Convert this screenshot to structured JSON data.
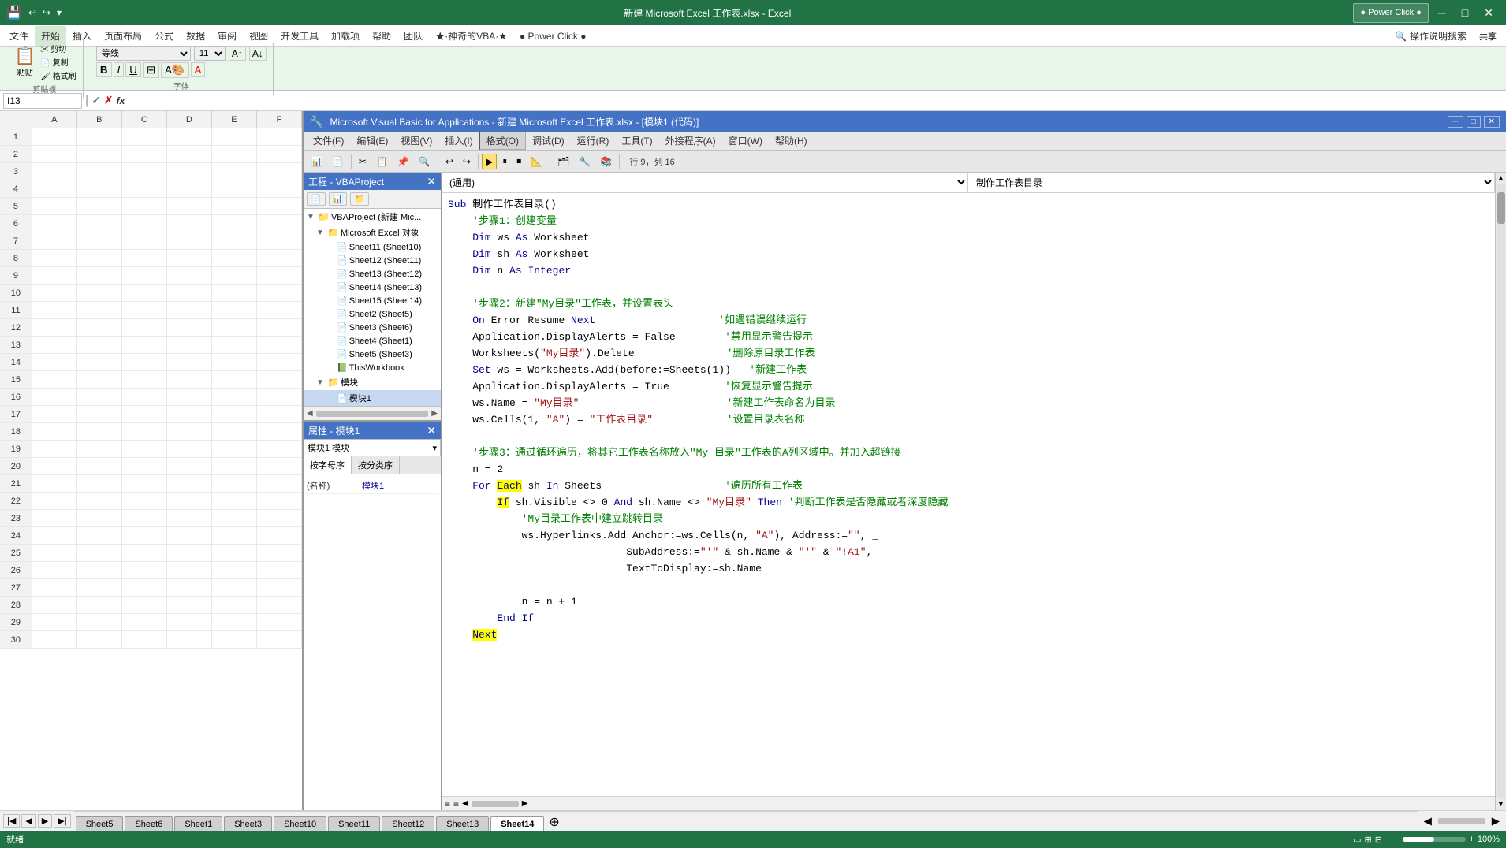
{
  "excel": {
    "title": "新建 Microsoft Excel 工作表.xlsx - Excel",
    "tabs": [
      "Sheet5",
      "Sheet6",
      "Sheet1",
      "Sheet3",
      "Sheet10",
      "Sheet11",
      "Sheet12",
      "Sheet13",
      "Sheet14"
    ],
    "active_tab": "Sheet14",
    "name_box": "I13",
    "ribbon": {
      "active_tab": "开始",
      "tabs": [
        "文件",
        "开始",
        "插入",
        "页面布局",
        "公式",
        "数据",
        "审阅",
        "视图",
        "开发工具",
        "加载项",
        "帮助",
        "团队",
        "★·神奇的VBA·★",
        "● Power Click ●",
        "操作说明搜索"
      ]
    }
  },
  "vba": {
    "title": "Microsoft Visual Basic for Applications - 新建 Microsoft Excel 工作表.xlsx - [模块1 (代码)]",
    "menus": [
      "文件(F)",
      "编辑(E)",
      "视图(V)",
      "插入(I)",
      "格式(O)",
      "调试(D)",
      "运行(R)",
      "工具(T)",
      "外接程序(A)",
      "窗口(W)",
      "帮助(H)"
    ],
    "active_menu": "格式(O)",
    "row_col": "行 9，列 16",
    "left_dropdown": "(通用)",
    "right_dropdown": "制作工作表目录",
    "project_panel": {
      "title": "工程 - VBAProject",
      "items": [
        {
          "label": "VBAProject (新建 Mic...",
          "level": 0,
          "type": "project",
          "expanded": true
        },
        {
          "label": "Microsoft Excel 对象",
          "level": 1,
          "type": "folder",
          "expanded": true
        },
        {
          "label": "Sheet11 (Sheet10)",
          "level": 2,
          "type": "sheet"
        },
        {
          "label": "Sheet12 (Sheet11)",
          "level": 2,
          "type": "sheet"
        },
        {
          "label": "Sheet13 (Sheet12)",
          "level": 2,
          "type": "sheet"
        },
        {
          "label": "Sheet14 (Sheet13)",
          "level": 2,
          "type": "sheet"
        },
        {
          "label": "Sheet15 (Sheet14)",
          "level": 2,
          "type": "sheet"
        },
        {
          "label": "Sheet2 (Sheet5)",
          "level": 2,
          "type": "sheet"
        },
        {
          "label": "Sheet3 (Sheet6)",
          "level": 2,
          "type": "sheet"
        },
        {
          "label": "Sheet4 (Sheet1)",
          "level": 2,
          "type": "sheet"
        },
        {
          "label": "Sheet5 (Sheet3)",
          "level": 2,
          "type": "sheet"
        },
        {
          "label": "ThisWorkbook",
          "level": 2,
          "type": "workbook"
        },
        {
          "label": "模块",
          "level": 1,
          "type": "folder",
          "expanded": true
        },
        {
          "label": "模块1",
          "level": 2,
          "type": "module",
          "selected": true
        }
      ]
    },
    "properties_panel": {
      "title": "属性 - 模块1",
      "dropdown": "模块1 模块",
      "tabs": [
        "按字母序",
        "按分类序"
      ],
      "active_tab": "按字母序",
      "name_value": "模块1"
    },
    "code": [
      {
        "type": "code",
        "content": "Sub 制作工作表目录()"
      },
      {
        "type": "comment",
        "content": "    '步骤1：创建变量"
      },
      {
        "type": "code",
        "content": "    Dim ws As Worksheet"
      },
      {
        "type": "code",
        "content": "    Dim sh As Worksheet"
      },
      {
        "type": "code",
        "content": "    Dim n As Integer"
      },
      {
        "type": "empty",
        "content": ""
      },
      {
        "type": "comment",
        "content": "    '步骤2：新建\"My目录\"工作表，并设置表头"
      },
      {
        "type": "code",
        "content": "    On Error Resume Next                    '如遇错误继续运行"
      },
      {
        "type": "code",
        "content": "    Application.DisplayAlerts = False        '禁用显示警告提示"
      },
      {
        "type": "code",
        "content": "    Worksheets(\"My目录\").Delete               '删除原目录工作表"
      },
      {
        "type": "code",
        "content": "    Set ws = Worksheets.Add(before:=Sheets(1))   '新建工作表"
      },
      {
        "type": "code",
        "content": "    Application.DisplayAlerts = True         '恢复显示警告提示"
      },
      {
        "type": "code",
        "content": "    ws.Name = \"My目录\"                        '新建工作表命名为目录"
      },
      {
        "type": "code",
        "content": "    ws.Cells(1, \"A\") = \"工作表目录\"            '设置目录表名称"
      },
      {
        "type": "empty",
        "content": ""
      },
      {
        "type": "comment",
        "content": "    '步骤3：通过循环遍历，将其它工作表名称放入\"My 目录\"工作表的A列区域中。并加入超链接"
      },
      {
        "type": "code",
        "content": "    n = 2"
      },
      {
        "type": "code",
        "content": "    For Each sh In Sheets                    '遍历所有工作表"
      },
      {
        "type": "code",
        "content": "        If sh.Visible <> 0 And sh.Name <> \"My目录\" Then '判断工作表是否隐藏或者深度隐藏"
      },
      {
        "type": "code",
        "content": "            'My目录工作表中建立跳转目录"
      },
      {
        "type": "code",
        "content": "            ws.Hyperlinks.Add Anchor:=ws.Cells(n, \"A\"), Address:=\"\", _"
      },
      {
        "type": "code",
        "content": "                             SubAddress:=\"'\" & sh.Name & \"'\" & \"!A1\", _"
      },
      {
        "type": "code",
        "content": "                             TextToDisplay:=sh.Name"
      },
      {
        "type": "empty",
        "content": ""
      },
      {
        "type": "code",
        "content": "            n = n + 1"
      },
      {
        "type": "code",
        "content": "        End If"
      },
      {
        "type": "code",
        "content": "    Next"
      }
    ]
  },
  "status": {
    "ready": "就绪",
    "zoom": "100%"
  }
}
